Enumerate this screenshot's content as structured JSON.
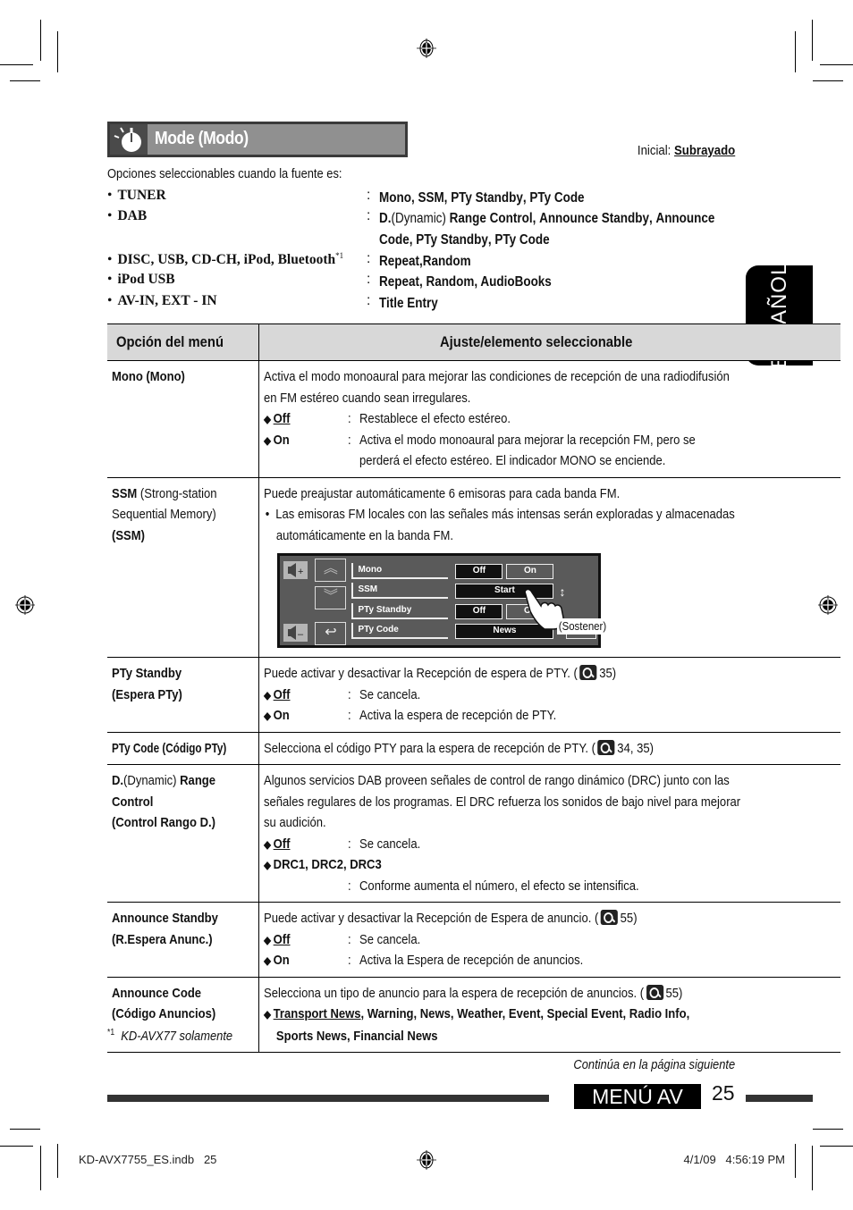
{
  "header": {
    "title": "Mode",
    "title_sub": "(Modo)",
    "initial_label": "Inicial:",
    "initial_value": "Subrayado",
    "intro": "Opciones seleccionables cuando la fuente es:"
  },
  "sources": [
    {
      "source": "TUNER",
      "options_html": "<b>Mono</b>, <b>SSM</b>, <b>PTy Standby</b>, <b>PTy Code</b>"
    },
    {
      "source": "DAB",
      "options_html": "<b>D.</b><span class='n'>(Dynamic)</span> <b>Range Control</b>, <b>Announce Standby</b>, <b>Announce</b><br><b>Code</b>, <b>PTy Standby</b>, <b>PTy Code</b>"
    },
    {
      "source": "DISC, USB, CD-CH, iPod, Bluetooth",
      "footnote_mark": "*1",
      "options_html": "<b>Repeat,Random</b>"
    },
    {
      "source": "iPod USB",
      "options_html": "<b>Repeat, Random, AudioBooks</b>"
    },
    {
      "source": "AV-IN, EXT - IN",
      "options_html": "<b>Title Entry</b>"
    }
  ],
  "table": {
    "col1_header": "Opción del menú",
    "col2_header": "Ajuste/elemento seleccionable",
    "rows": [
      {
        "item": "Mono (Mono)",
        "desc": [
          "Activa el modo monoaural para mejorar las condiciones de recepción de una radiodifusión",
          "en FM estéreo cuando sean irregulares."
        ],
        "options": [
          {
            "key": "Off",
            "default": true,
            "text": "Restablece el efecto estéreo."
          },
          {
            "key": "On",
            "default": false,
            "text": "Activa el modo monoaural para mejorar la recepción FM, pero se",
            "text2": "perderá el efecto estéreo. El indicador MONO se enciende."
          }
        ]
      },
      {
        "item_bold": "SSM",
        "item_rest": " (Strong-station Sequential Memory)",
        "item_sub": "(SSM)",
        "desc": [
          "Puede preajustar automáticamente 6 emisoras para cada banda FM."
        ],
        "bullet": [
          "Las emisoras FM locales con las señales más intensas serán exploradas y almacenadas",
          "automáticamente en la banda FM."
        ],
        "screen": {
          "labels": [
            "Mono",
            "SSM",
            "PTy Standby",
            "PTy Code"
          ],
          "mono_off": "Off",
          "mono_on": "On",
          "ssm_start": "Start",
          "pty_off": "Off",
          "pty_on": "On",
          "pty_code": "News",
          "hold_label": "(Sostener)"
        }
      },
      {
        "item": "PTy Standby",
        "item_sub": "(Espera PTy)",
        "desc": "Puede activar y desactivar la Recepción de espera de PTY. (",
        "ref": "35)",
        "options": [
          {
            "key": "Off",
            "default": true,
            "text": "Se cancela."
          },
          {
            "key": "On",
            "default": false,
            "text": "Activa la espera de recepción de PTY."
          }
        ]
      },
      {
        "item": "PTy Code (Código PTy)",
        "desc": "Selecciona el código PTY para la espera de recepción de PTY. (",
        "ref": "34, 35)"
      },
      {
        "item_bold": "D.",
        "item_rest": "(Dynamic)",
        "item_bold2": " Range Control",
        "item_sub": "(Control Rango D.)",
        "desc": [
          "Algunos servicios DAB proveen señales de control de rango dinámico (DRC) junto con las",
          "señales regulares de los programas. El DRC refuerza los sonidos de bajo nivel para mejorar",
          "su audición."
        ],
        "options": [
          {
            "key": "Off",
            "default": true,
            "text": "Se cancela."
          },
          {
            "key": "DRC1, DRC2,  DRC3",
            "default": false,
            "text": "Conforme aumenta el número, el efecto se intensifica."
          }
        ]
      },
      {
        "item": "Announce Standby",
        "item_sub": "(R.Espera Anunc.)",
        "desc": "Puede activar y desactivar la Recepción de Espera de anuncio. (",
        "ref": "55)",
        "options": [
          {
            "key": "Off",
            "default": true,
            "text": "Se cancela."
          },
          {
            "key": "On",
            "default": false,
            "text": "Activa la Espera de recepción de anuncios."
          }
        ]
      },
      {
        "item": "Announce Code",
        "item_sub": "(Código Anuncios)",
        "desc": "Selecciona un tipo de anuncio para la espera de recepción de anuncios. (",
        "ref": "55)",
        "default_option": "Transport News",
        "options_rest": ", Warning, News, Weather, Event, Special Event, Radio Info,",
        "options_rest2": "Sports News, Financial News"
      }
    ]
  },
  "footnote": {
    "mark": "*1",
    "text": "KD-AVX77 solamente"
  },
  "continue_text": "Continúa en la página siguiente",
  "section_tab": "MENÚ AV",
  "page_number": "25",
  "language_tab": "ESPAÑOL",
  "slug": {
    "file": "KD-AVX7755_ES.indb   25",
    "datetime": "4/1/09   4:56:19 PM"
  }
}
